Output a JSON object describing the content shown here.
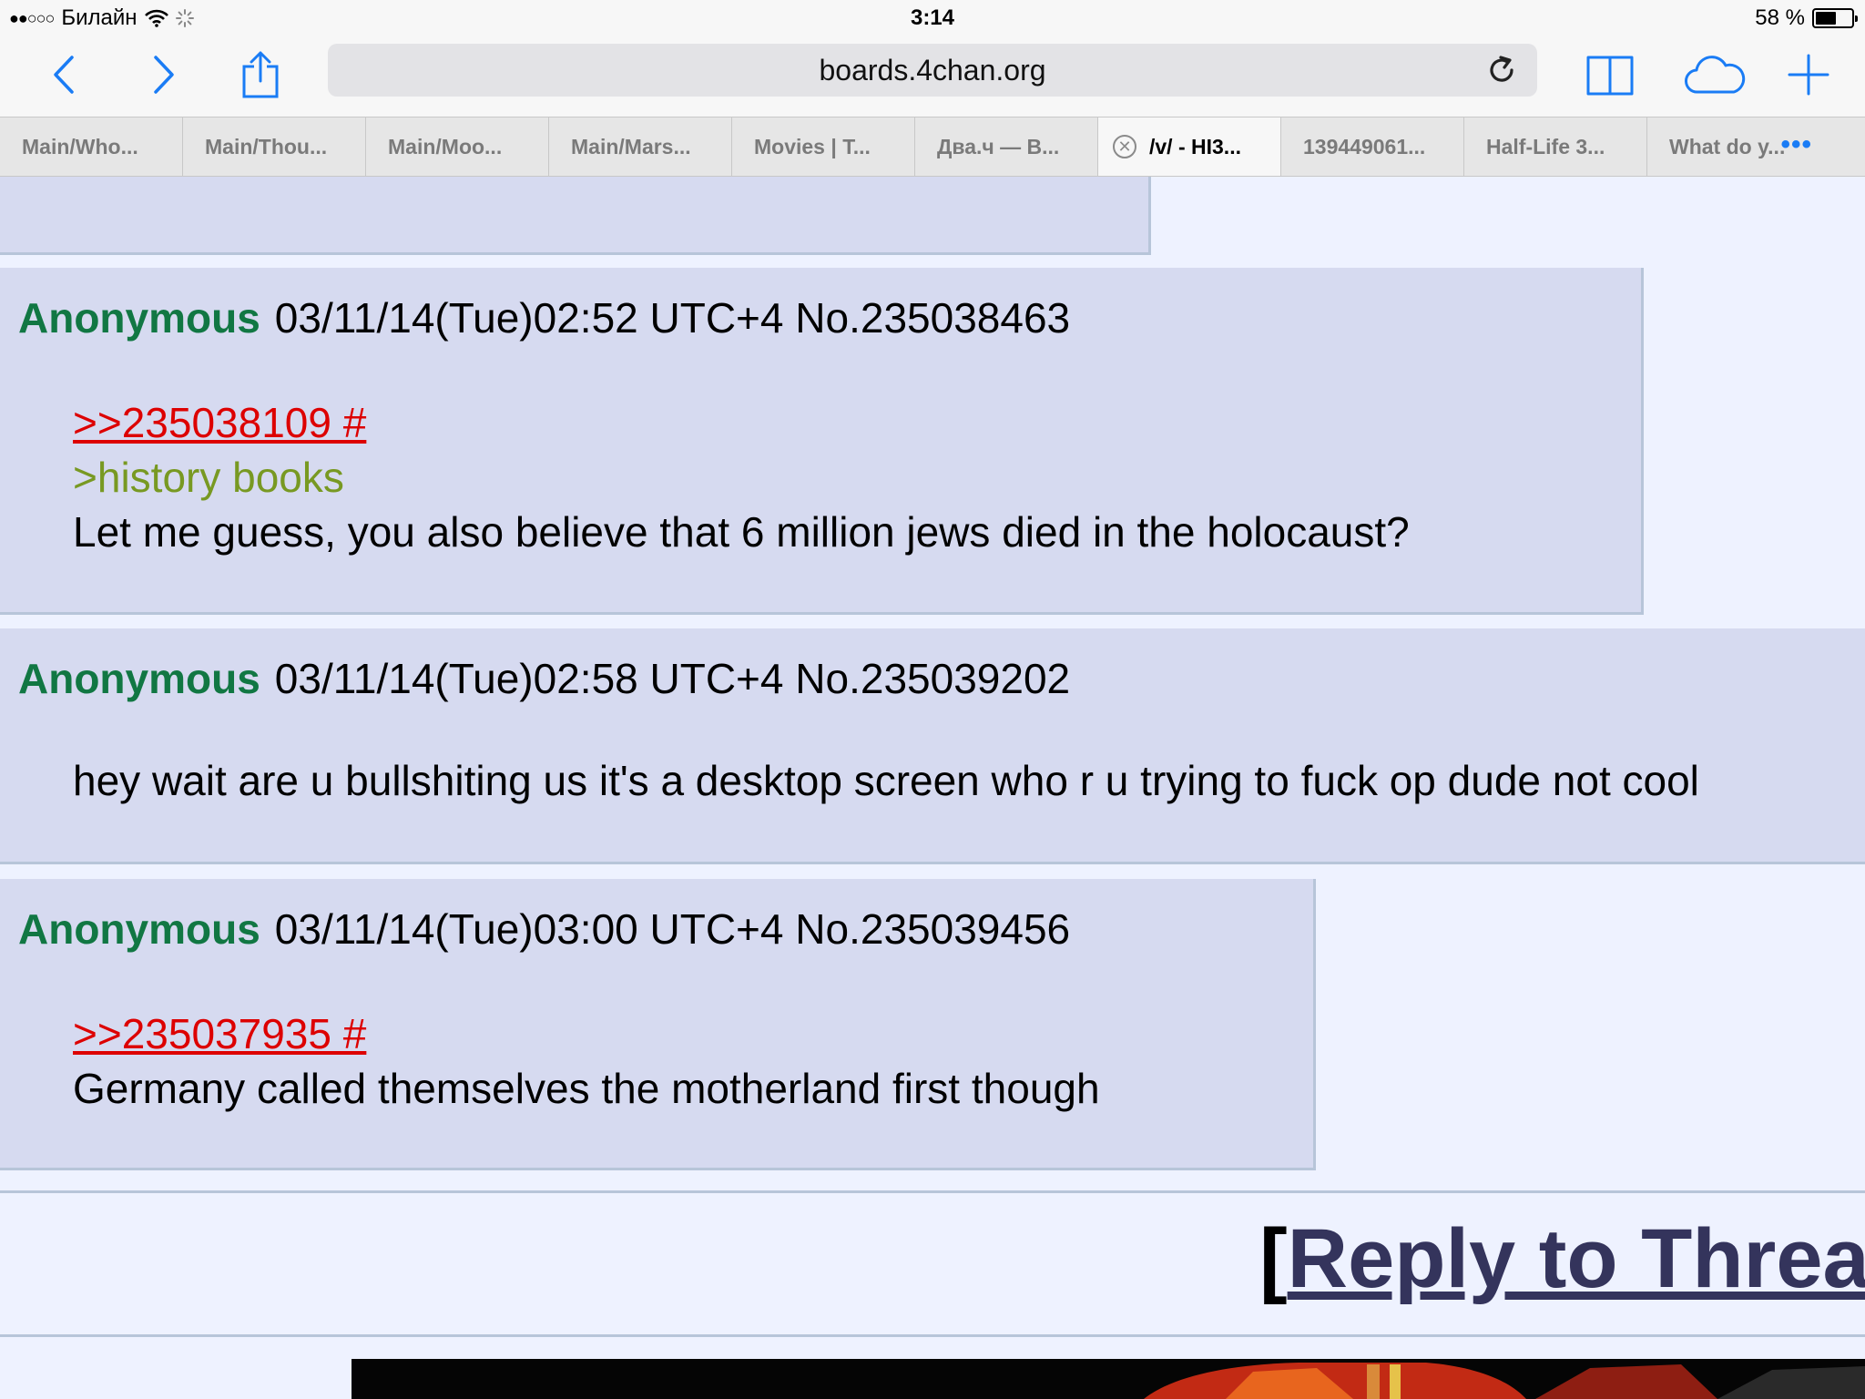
{
  "status_bar": {
    "carrier": "Билайн",
    "time": "3:14",
    "battery_percent": "58 %",
    "battery_level": 0.58
  },
  "toolbar": {
    "url": "boards.4chan.org"
  },
  "tabs": [
    {
      "label": "Main/Who..."
    },
    {
      "label": "Main/Thou..."
    },
    {
      "label": "Main/Moo..."
    },
    {
      "label": "Main/Mars..."
    },
    {
      "label": "Movies | T..."
    },
    {
      "label": "Два.ч — В..."
    },
    {
      "label": "/v/ - HI3...",
      "active": true
    },
    {
      "label": "139449061..."
    },
    {
      "label": "Half-Life 3..."
    },
    {
      "label": "What do y..."
    }
  ],
  "posts": [
    {
      "name": "Anonymous",
      "datetime": "03/11/14(Tue)02:52 UTC+4",
      "number": "No.235038463",
      "quote": ">>235038109 #",
      "greentext": ">history books",
      "text": "Let me guess, you also believe that 6 million jews died in the holocaust?"
    },
    {
      "name": "Anonymous",
      "datetime": "03/11/14(Tue)02:58 UTC+4",
      "number": "No.235039202",
      "text": "hey wait are u bullshiting us it's a desktop screen who r u trying to fuck op dude not cool"
    },
    {
      "name": "Anonymous",
      "datetime": "03/11/14(Tue)03:00 UTC+4",
      "number": "No.235039456",
      "quote": ">>235037935 #",
      "text": "Germany called themselves the motherland first though"
    }
  ],
  "reply_link": {
    "bracket": "[",
    "label": "Reply to Threa"
  },
  "colors": {
    "name_green": "#117743",
    "quote_red": "#dd0000",
    "greentext": "#789922",
    "post_bg": "#d6daf0",
    "page_bg": "#eef2ff",
    "ios_blue": "#1a7cf5"
  }
}
